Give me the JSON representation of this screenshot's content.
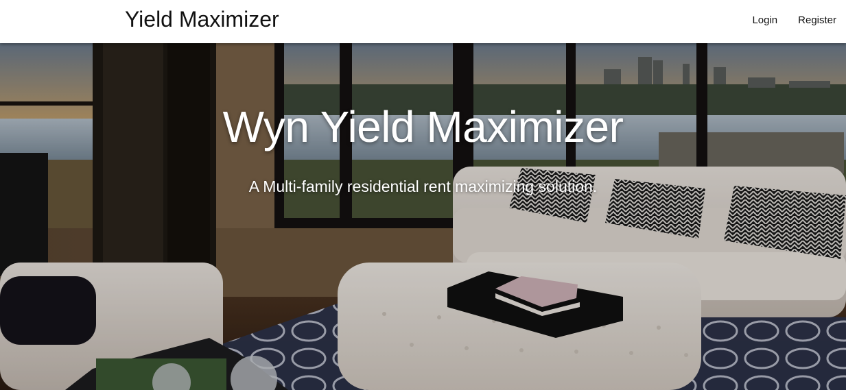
{
  "navbar": {
    "brand": "Yield Maximizer",
    "links": [
      {
        "label": "Login"
      },
      {
        "label": "Register"
      }
    ]
  },
  "hero": {
    "title": "Wyn Yield Maximizer",
    "subtitle": "A Multi-family residential rent maximizing solution.",
    "background_image": "living-room-with-city-view"
  },
  "colors": {
    "navbar_bg": "#ffffff",
    "text_dark": "#111111",
    "hero_text": "#ffffff"
  }
}
